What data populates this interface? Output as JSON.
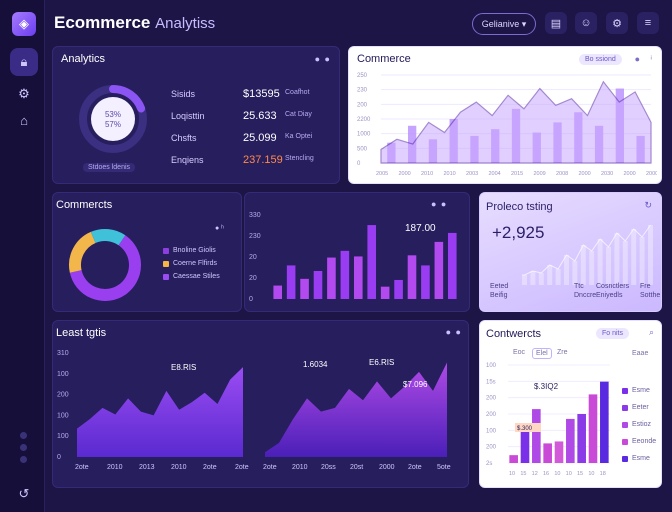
{
  "app": {
    "title": "Ecommerce",
    "subtitle": "Analytiss"
  },
  "header": {
    "button_label": "Gelianive ▾"
  },
  "analytics": {
    "title": "Analytics",
    "donut": {
      "value1": "53%",
      "value2": "57%",
      "fraction": 0.55
    },
    "footer": "Stdoes ldenis",
    "rows": [
      {
        "label": "Sisids",
        "value": "$13595",
        "note": "Coafhot",
        "color": "#ffffff"
      },
      {
        "label": "Loqisttin",
        "value": "25.633",
        "note": "Cat Diay",
        "color": "#ffffff"
      },
      {
        "label": "Chsfts",
        "value": "25.099",
        "note": "Ka Optei",
        "color": "#ffffff"
      },
      {
        "label": "Enqiens",
        "value": "237.159",
        "note": "Stencling",
        "color": "#ff8a4c"
      }
    ]
  },
  "commerce_top": {
    "title": "Commerce",
    "badge": "Bo ssiond",
    "chart_data": {
      "type": "area",
      "x": [
        "2005",
        "2000",
        "2010",
        "2010",
        "2003",
        "2004",
        "2015",
        "2009",
        "2008",
        "2000",
        "2030",
        "2000",
        "2000"
      ],
      "yticks": [
        "250",
        "230",
        "200",
        "2200",
        "1000",
        "500",
        "0"
      ],
      "area_values": [
        20,
        35,
        28,
        60,
        45,
        75,
        90,
        70,
        100,
        80,
        110,
        85,
        95,
        70,
        120,
        90,
        105,
        60
      ],
      "bar_values": [
        30,
        55,
        35,
        65,
        40,
        50,
        80,
        45,
        60,
        75,
        55,
        110,
        40
      ],
      "ylim": [
        0,
        130
      ]
    }
  },
  "commercts": {
    "title": "Commercts",
    "legend": [
      {
        "label": "Bnoline Giolis",
        "color": "#8e3ee0"
      },
      {
        "label": "Coerne Flfirds",
        "color": "#f6b440"
      },
      {
        "label": "Caessae Stiles",
        "color": "#9a4cf2"
      }
    ],
    "donut_slices": [
      {
        "value": 0.62,
        "color": "#9a3ff0"
      },
      {
        "value": 0.22,
        "color": "#f2b64a"
      },
      {
        "value": 0.16,
        "color": "#3fc1d9"
      }
    ]
  },
  "bars_mid": {
    "label": "187.00",
    "chart_data": {
      "type": "bar",
      "yticks": [
        "330",
        "230",
        "20",
        "20",
        "0"
      ],
      "values": [
        12,
        30,
        18,
        25,
        37,
        43,
        38,
        66,
        11,
        17,
        39,
        30,
        51,
        59
      ],
      "ylim": [
        0,
        75
      ]
    }
  },
  "forecasting": {
    "title": "Proleco tsting",
    "value": "+2,925",
    "footer": [
      {
        "line1": "Eeted",
        "line2": "Beifig"
      },
      {
        "line1": "Ttc",
        "line2": "Dnccre"
      },
      {
        "line1": "Cosnctlers",
        "line2": "Eniyedls"
      },
      {
        "line1": "Fre",
        "line2": "Sotthe"
      }
    ]
  },
  "least": {
    "title": "Least tgtis",
    "chart_data": {
      "type": "area",
      "yticks": [
        "310",
        "100",
        "200",
        "100",
        "100",
        "0"
      ],
      "x_left": [
        "2ote",
        "2010",
        "2013",
        "2010",
        "2ote",
        "2ote"
      ],
      "x_right": [
        "2ote",
        "2010",
        "20ss",
        "20st",
        "2000",
        "2ote",
        "5ote"
      ],
      "left_values": [
        30,
        40,
        52,
        45,
        62,
        48,
        44,
        70,
        50,
        58,
        68,
        56,
        82,
        95
      ],
      "right_values": [
        5,
        15,
        40,
        62,
        48,
        52,
        72,
        60,
        80,
        62,
        75,
        90,
        70,
        100
      ],
      "labels": [
        "E8.RIS",
        "1.6034",
        "E6.RIS",
        "$7.096"
      ]
    }
  },
  "contwercts": {
    "title": "Contwercts",
    "badge": "Fo nits",
    "tabs": [
      "Eoc",
      "Elel",
      "Zre"
    ],
    "right_label": "Eaae",
    "labels": [
      "$.3IQ2",
      "$.300"
    ],
    "chart_data": {
      "type": "bar",
      "yticks": [
        "100",
        "15s",
        "200",
        "200",
        "100",
        "200",
        "2s"
      ],
      "x": [
        "10",
        "15",
        "12",
        "16",
        "10",
        "10",
        "15",
        "10",
        "18"
      ],
      "values": [
        8,
        40,
        55,
        20,
        22,
        45,
        50,
        70,
        83
      ],
      "ylim": [
        0,
        100
      ]
    },
    "legend": [
      {
        "label": "Esme",
        "color": "#7a2fe8"
      },
      {
        "label": "Eeter",
        "color": "#8a3ae6"
      },
      {
        "label": "Estioz",
        "color": "#b04ae6"
      },
      {
        "label": "Eeonde",
        "color": "#c94ad6"
      },
      {
        "label": "Esme",
        "color": "#5a2ae0"
      }
    ]
  }
}
